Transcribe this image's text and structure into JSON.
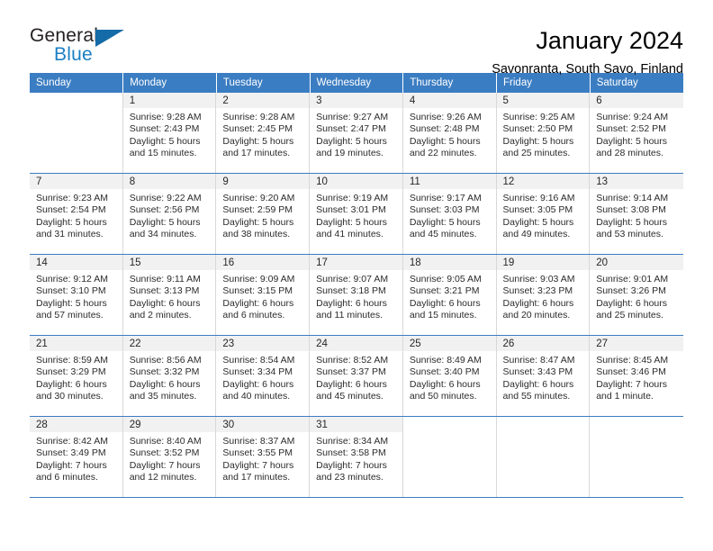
{
  "brand": {
    "word_top": "General",
    "word_bottom": "Blue",
    "triangle_color": "#156ba8",
    "blue_text_color": "#1c7fc4"
  },
  "header": {
    "title": "January 2024",
    "subtitle": "Savonranta, South Savo, Finland"
  },
  "theme": {
    "header_row_bg": "#3b7dc2",
    "daynum_band_bg": "#f1f1f1",
    "cell_border": "#d8d8d8"
  },
  "weekday_headers": [
    "Sunday",
    "Monday",
    "Tuesday",
    "Wednesday",
    "Thursday",
    "Friday",
    "Saturday"
  ],
  "weeks": [
    [
      {
        "day": "",
        "lines": []
      },
      {
        "day": "1",
        "lines": [
          "Sunrise: 9:28 AM",
          "Sunset: 2:43 PM",
          "Daylight: 5 hours",
          "and 15 minutes."
        ]
      },
      {
        "day": "2",
        "lines": [
          "Sunrise: 9:28 AM",
          "Sunset: 2:45 PM",
          "Daylight: 5 hours",
          "and 17 minutes."
        ]
      },
      {
        "day": "3",
        "lines": [
          "Sunrise: 9:27 AM",
          "Sunset: 2:47 PM",
          "Daylight: 5 hours",
          "and 19 minutes."
        ]
      },
      {
        "day": "4",
        "lines": [
          "Sunrise: 9:26 AM",
          "Sunset: 2:48 PM",
          "Daylight: 5 hours",
          "and 22 minutes."
        ]
      },
      {
        "day": "5",
        "lines": [
          "Sunrise: 9:25 AM",
          "Sunset: 2:50 PM",
          "Daylight: 5 hours",
          "and 25 minutes."
        ]
      },
      {
        "day": "6",
        "lines": [
          "Sunrise: 9:24 AM",
          "Sunset: 2:52 PM",
          "Daylight: 5 hours",
          "and 28 minutes."
        ]
      }
    ],
    [
      {
        "day": "7",
        "lines": [
          "Sunrise: 9:23 AM",
          "Sunset: 2:54 PM",
          "Daylight: 5 hours",
          "and 31 minutes."
        ]
      },
      {
        "day": "8",
        "lines": [
          "Sunrise: 9:22 AM",
          "Sunset: 2:56 PM",
          "Daylight: 5 hours",
          "and 34 minutes."
        ]
      },
      {
        "day": "9",
        "lines": [
          "Sunrise: 9:20 AM",
          "Sunset: 2:59 PM",
          "Daylight: 5 hours",
          "and 38 minutes."
        ]
      },
      {
        "day": "10",
        "lines": [
          "Sunrise: 9:19 AM",
          "Sunset: 3:01 PM",
          "Daylight: 5 hours",
          "and 41 minutes."
        ]
      },
      {
        "day": "11",
        "lines": [
          "Sunrise: 9:17 AM",
          "Sunset: 3:03 PM",
          "Daylight: 5 hours",
          "and 45 minutes."
        ]
      },
      {
        "day": "12",
        "lines": [
          "Sunrise: 9:16 AM",
          "Sunset: 3:05 PM",
          "Daylight: 5 hours",
          "and 49 minutes."
        ]
      },
      {
        "day": "13",
        "lines": [
          "Sunrise: 9:14 AM",
          "Sunset: 3:08 PM",
          "Daylight: 5 hours",
          "and 53 minutes."
        ]
      }
    ],
    [
      {
        "day": "14",
        "lines": [
          "Sunrise: 9:12 AM",
          "Sunset: 3:10 PM",
          "Daylight: 5 hours",
          "and 57 minutes."
        ]
      },
      {
        "day": "15",
        "lines": [
          "Sunrise: 9:11 AM",
          "Sunset: 3:13 PM",
          "Daylight: 6 hours",
          "and 2 minutes."
        ]
      },
      {
        "day": "16",
        "lines": [
          "Sunrise: 9:09 AM",
          "Sunset: 3:15 PM",
          "Daylight: 6 hours",
          "and 6 minutes."
        ]
      },
      {
        "day": "17",
        "lines": [
          "Sunrise: 9:07 AM",
          "Sunset: 3:18 PM",
          "Daylight: 6 hours",
          "and 11 minutes."
        ]
      },
      {
        "day": "18",
        "lines": [
          "Sunrise: 9:05 AM",
          "Sunset: 3:21 PM",
          "Daylight: 6 hours",
          "and 15 minutes."
        ]
      },
      {
        "day": "19",
        "lines": [
          "Sunrise: 9:03 AM",
          "Sunset: 3:23 PM",
          "Daylight: 6 hours",
          "and 20 minutes."
        ]
      },
      {
        "day": "20",
        "lines": [
          "Sunrise: 9:01 AM",
          "Sunset: 3:26 PM",
          "Daylight: 6 hours",
          "and 25 minutes."
        ]
      }
    ],
    [
      {
        "day": "21",
        "lines": [
          "Sunrise: 8:59 AM",
          "Sunset: 3:29 PM",
          "Daylight: 6 hours",
          "and 30 minutes."
        ]
      },
      {
        "day": "22",
        "lines": [
          "Sunrise: 8:56 AM",
          "Sunset: 3:32 PM",
          "Daylight: 6 hours",
          "and 35 minutes."
        ]
      },
      {
        "day": "23",
        "lines": [
          "Sunrise: 8:54 AM",
          "Sunset: 3:34 PM",
          "Daylight: 6 hours",
          "and 40 minutes."
        ]
      },
      {
        "day": "24",
        "lines": [
          "Sunrise: 8:52 AM",
          "Sunset: 3:37 PM",
          "Daylight: 6 hours",
          "and 45 minutes."
        ]
      },
      {
        "day": "25",
        "lines": [
          "Sunrise: 8:49 AM",
          "Sunset: 3:40 PM",
          "Daylight: 6 hours",
          "and 50 minutes."
        ]
      },
      {
        "day": "26",
        "lines": [
          "Sunrise: 8:47 AM",
          "Sunset: 3:43 PM",
          "Daylight: 6 hours",
          "and 55 minutes."
        ]
      },
      {
        "day": "27",
        "lines": [
          "Sunrise: 8:45 AM",
          "Sunset: 3:46 PM",
          "Daylight: 7 hours",
          "and 1 minute."
        ]
      }
    ],
    [
      {
        "day": "28",
        "lines": [
          "Sunrise: 8:42 AM",
          "Sunset: 3:49 PM",
          "Daylight: 7 hours",
          "and 6 minutes."
        ]
      },
      {
        "day": "29",
        "lines": [
          "Sunrise: 8:40 AM",
          "Sunset: 3:52 PM",
          "Daylight: 7 hours",
          "and 12 minutes."
        ]
      },
      {
        "day": "30",
        "lines": [
          "Sunrise: 8:37 AM",
          "Sunset: 3:55 PM",
          "Daylight: 7 hours",
          "and 17 minutes."
        ]
      },
      {
        "day": "31",
        "lines": [
          "Sunrise: 8:34 AM",
          "Sunset: 3:58 PM",
          "Daylight: 7 hours",
          "and 23 minutes."
        ]
      },
      {
        "day": "",
        "lines": []
      },
      {
        "day": "",
        "lines": []
      },
      {
        "day": "",
        "lines": []
      }
    ]
  ]
}
